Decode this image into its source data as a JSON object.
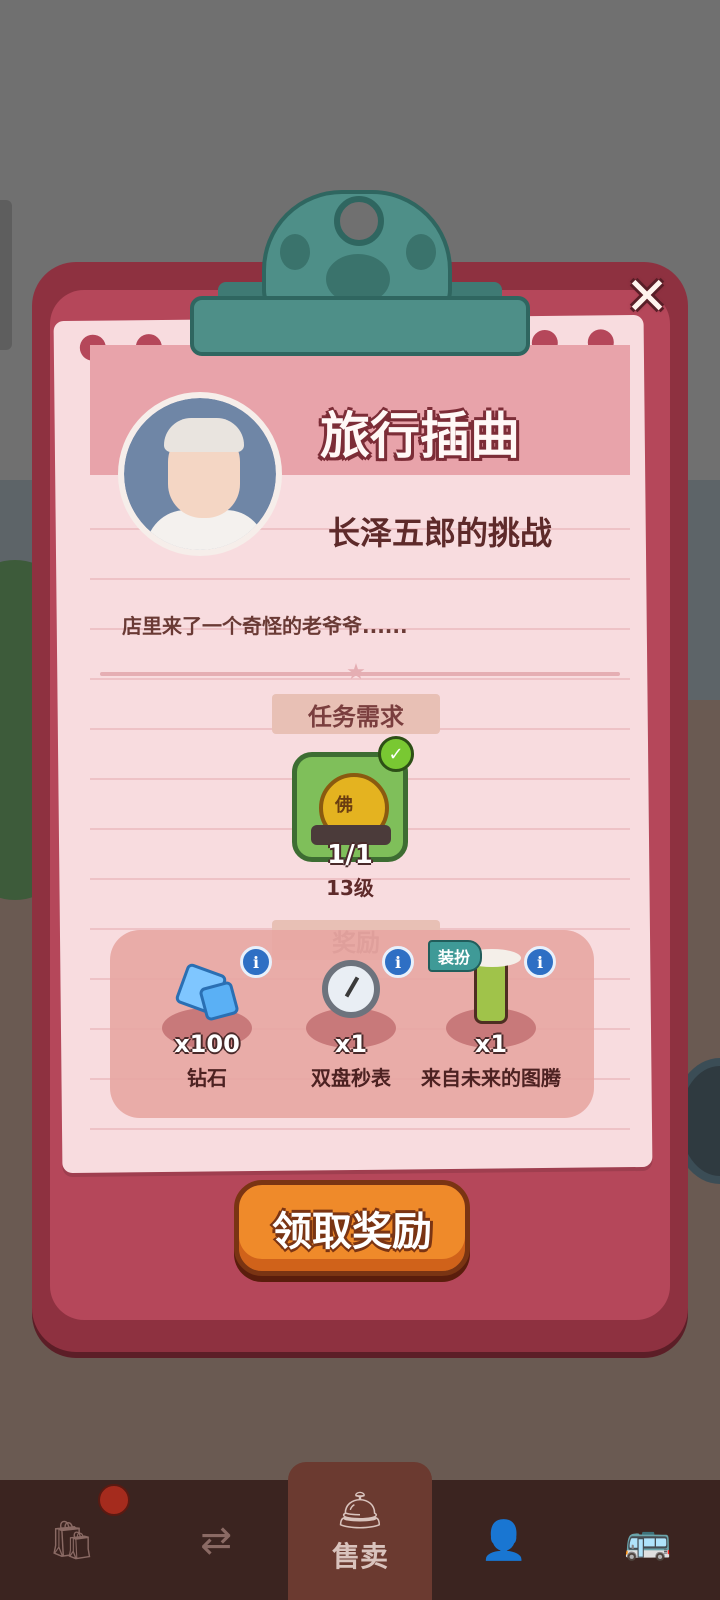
{
  "dialog": {
    "title": "旅行插曲",
    "subtitle": "长泽五郎的挑战",
    "description": "店里来了一个奇怪的老爷爷......",
    "requirement_header": "任务需求",
    "requirement": {
      "count": "1/1",
      "level": "13级",
      "item_icon": "buddha-treasure-pot-icon",
      "pot_char": "佛",
      "completed": true
    },
    "reward_header": "奖励",
    "rewards": [
      {
        "qty": "x100",
        "name": "钻石",
        "icon": "diamond-icon"
      },
      {
        "qty": "x1",
        "name": "双盘秒表",
        "icon": "stopwatch-icon"
      },
      {
        "qty": "x1",
        "name": "来自未来的图腾",
        "icon": "totem-icon",
        "tag": "装扮"
      }
    ],
    "claim_label": "领取奖励",
    "close_icon": "✕",
    "info_icon": "i",
    "check_icon": "✓"
  },
  "bottom_nav": {
    "items": [
      {
        "icon": "bag-icon",
        "glyph": "🛍",
        "label": ""
      },
      {
        "icon": "arrows-icon",
        "glyph": "⇄",
        "label": ""
      },
      {
        "icon": "service-bell-icon",
        "glyph": "🛎",
        "label": "售卖"
      },
      {
        "icon": "chef-avatar-icon",
        "glyph": "👤",
        "label": ""
      },
      {
        "icon": "bus-icon",
        "glyph": "🚌",
        "label": ""
      }
    ]
  },
  "colors": {
    "dialog": "#8e3140",
    "paper": "#f8dcdf",
    "claim_button": "#ef8a2a",
    "clip": "#4e8f88"
  }
}
